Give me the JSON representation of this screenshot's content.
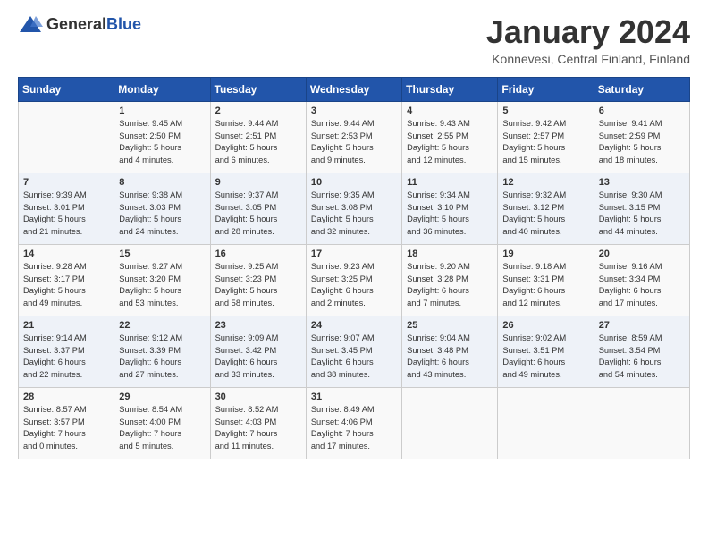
{
  "header": {
    "logo_general": "General",
    "logo_blue": "Blue",
    "month": "January 2024",
    "location": "Konnevesi, Central Finland, Finland"
  },
  "days_of_week": [
    "Sunday",
    "Monday",
    "Tuesday",
    "Wednesday",
    "Thursday",
    "Friday",
    "Saturday"
  ],
  "weeks": [
    [
      {
        "day": "",
        "info": ""
      },
      {
        "day": "1",
        "info": "Sunrise: 9:45 AM\nSunset: 2:50 PM\nDaylight: 5 hours\nand 4 minutes."
      },
      {
        "day": "2",
        "info": "Sunrise: 9:44 AM\nSunset: 2:51 PM\nDaylight: 5 hours\nand 6 minutes."
      },
      {
        "day": "3",
        "info": "Sunrise: 9:44 AM\nSunset: 2:53 PM\nDaylight: 5 hours\nand 9 minutes."
      },
      {
        "day": "4",
        "info": "Sunrise: 9:43 AM\nSunset: 2:55 PM\nDaylight: 5 hours\nand 12 minutes."
      },
      {
        "day": "5",
        "info": "Sunrise: 9:42 AM\nSunset: 2:57 PM\nDaylight: 5 hours\nand 15 minutes."
      },
      {
        "day": "6",
        "info": "Sunrise: 9:41 AM\nSunset: 2:59 PM\nDaylight: 5 hours\nand 18 minutes."
      }
    ],
    [
      {
        "day": "7",
        "info": "Sunrise: 9:39 AM\nSunset: 3:01 PM\nDaylight: 5 hours\nand 21 minutes."
      },
      {
        "day": "8",
        "info": "Sunrise: 9:38 AM\nSunset: 3:03 PM\nDaylight: 5 hours\nand 24 minutes."
      },
      {
        "day": "9",
        "info": "Sunrise: 9:37 AM\nSunset: 3:05 PM\nDaylight: 5 hours\nand 28 minutes."
      },
      {
        "day": "10",
        "info": "Sunrise: 9:35 AM\nSunset: 3:08 PM\nDaylight: 5 hours\nand 32 minutes."
      },
      {
        "day": "11",
        "info": "Sunrise: 9:34 AM\nSunset: 3:10 PM\nDaylight: 5 hours\nand 36 minutes."
      },
      {
        "day": "12",
        "info": "Sunrise: 9:32 AM\nSunset: 3:12 PM\nDaylight: 5 hours\nand 40 minutes."
      },
      {
        "day": "13",
        "info": "Sunrise: 9:30 AM\nSunset: 3:15 PM\nDaylight: 5 hours\nand 44 minutes."
      }
    ],
    [
      {
        "day": "14",
        "info": "Sunrise: 9:28 AM\nSunset: 3:17 PM\nDaylight: 5 hours\nand 49 minutes."
      },
      {
        "day": "15",
        "info": "Sunrise: 9:27 AM\nSunset: 3:20 PM\nDaylight: 5 hours\nand 53 minutes."
      },
      {
        "day": "16",
        "info": "Sunrise: 9:25 AM\nSunset: 3:23 PM\nDaylight: 5 hours\nand 58 minutes."
      },
      {
        "day": "17",
        "info": "Sunrise: 9:23 AM\nSunset: 3:25 PM\nDaylight: 6 hours\nand 2 minutes."
      },
      {
        "day": "18",
        "info": "Sunrise: 9:20 AM\nSunset: 3:28 PM\nDaylight: 6 hours\nand 7 minutes."
      },
      {
        "day": "19",
        "info": "Sunrise: 9:18 AM\nSunset: 3:31 PM\nDaylight: 6 hours\nand 12 minutes."
      },
      {
        "day": "20",
        "info": "Sunrise: 9:16 AM\nSunset: 3:34 PM\nDaylight: 6 hours\nand 17 minutes."
      }
    ],
    [
      {
        "day": "21",
        "info": "Sunrise: 9:14 AM\nSunset: 3:37 PM\nDaylight: 6 hours\nand 22 minutes."
      },
      {
        "day": "22",
        "info": "Sunrise: 9:12 AM\nSunset: 3:39 PM\nDaylight: 6 hours\nand 27 minutes."
      },
      {
        "day": "23",
        "info": "Sunrise: 9:09 AM\nSunset: 3:42 PM\nDaylight: 6 hours\nand 33 minutes."
      },
      {
        "day": "24",
        "info": "Sunrise: 9:07 AM\nSunset: 3:45 PM\nDaylight: 6 hours\nand 38 minutes."
      },
      {
        "day": "25",
        "info": "Sunrise: 9:04 AM\nSunset: 3:48 PM\nDaylight: 6 hours\nand 43 minutes."
      },
      {
        "day": "26",
        "info": "Sunrise: 9:02 AM\nSunset: 3:51 PM\nDaylight: 6 hours\nand 49 minutes."
      },
      {
        "day": "27",
        "info": "Sunrise: 8:59 AM\nSunset: 3:54 PM\nDaylight: 6 hours\nand 54 minutes."
      }
    ],
    [
      {
        "day": "28",
        "info": "Sunrise: 8:57 AM\nSunset: 3:57 PM\nDaylight: 7 hours\nand 0 minutes."
      },
      {
        "day": "29",
        "info": "Sunrise: 8:54 AM\nSunset: 4:00 PM\nDaylight: 7 hours\nand 5 minutes."
      },
      {
        "day": "30",
        "info": "Sunrise: 8:52 AM\nSunset: 4:03 PM\nDaylight: 7 hours\nand 11 minutes."
      },
      {
        "day": "31",
        "info": "Sunrise: 8:49 AM\nSunset: 4:06 PM\nDaylight: 7 hours\nand 17 minutes."
      },
      {
        "day": "",
        "info": ""
      },
      {
        "day": "",
        "info": ""
      },
      {
        "day": "",
        "info": ""
      }
    ]
  ]
}
